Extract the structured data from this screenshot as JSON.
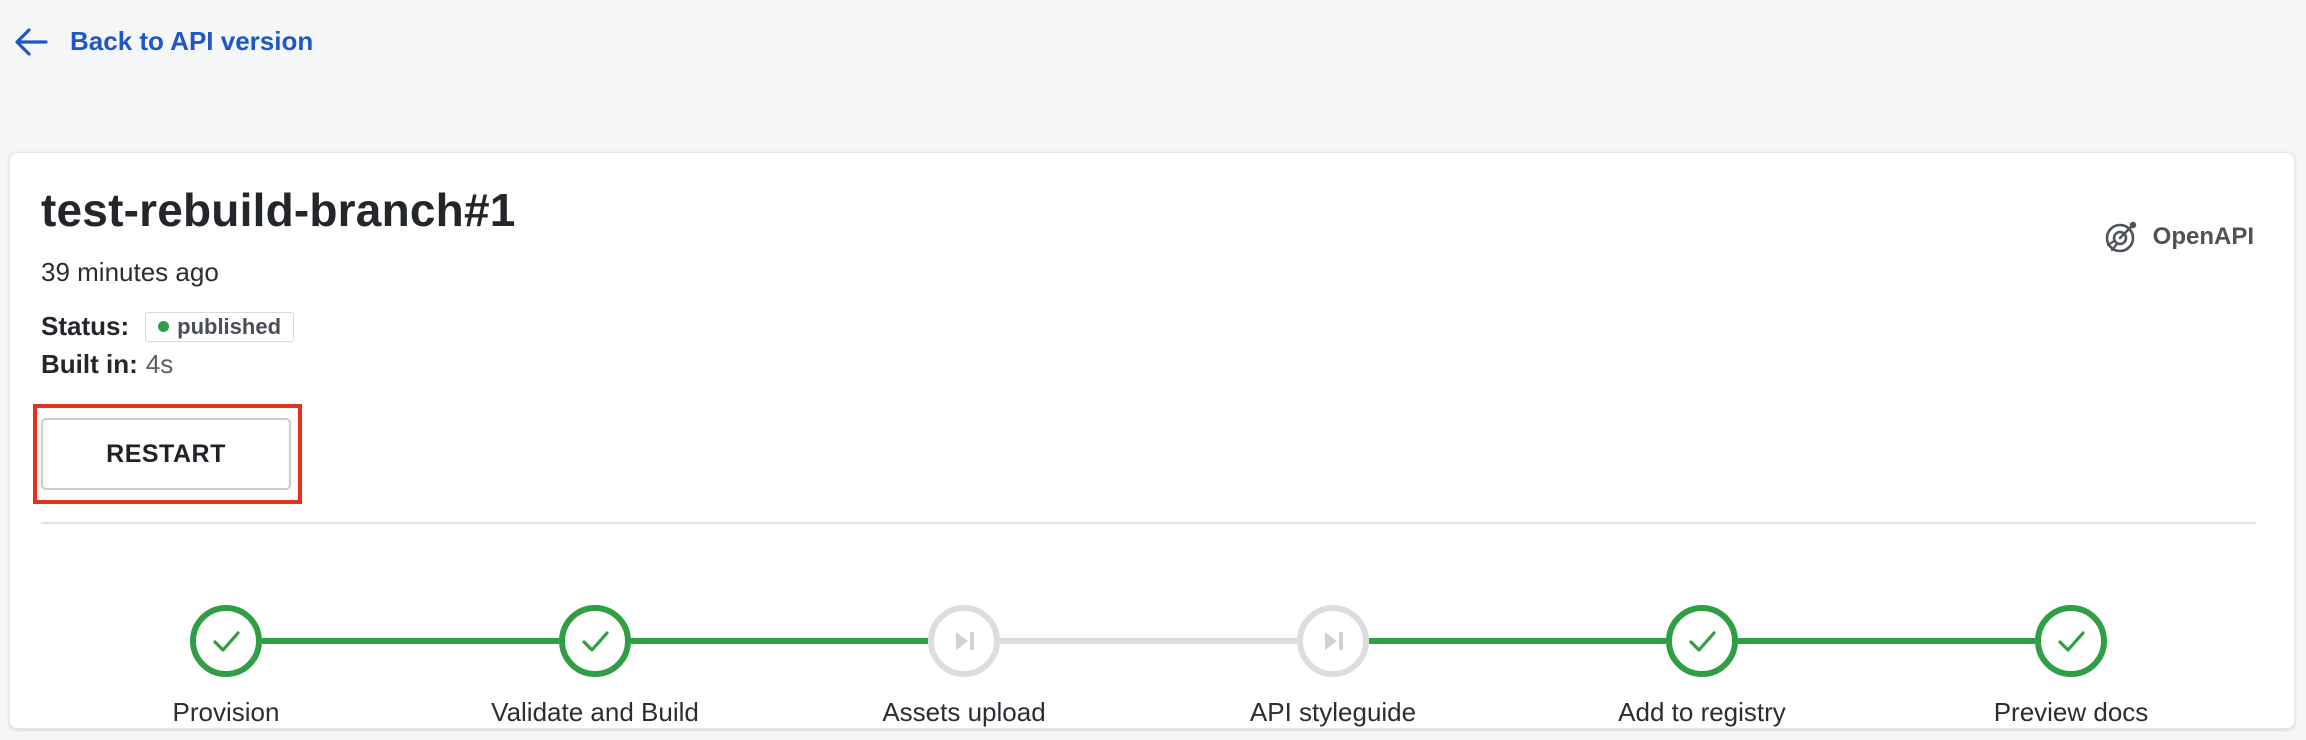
{
  "nav": {
    "back_label": "Back to API version"
  },
  "build": {
    "title": "test-rebuild-branch#1",
    "time_ago": "39 minutes ago",
    "status_label": "Status:",
    "status_value": "published",
    "built_in_label": "Built in:",
    "built_in_value": "4s",
    "restart_label": "RESTART",
    "api_type": "OpenAPI"
  },
  "colors": {
    "link": "#1f57c7",
    "success": "#2f9e44",
    "pending": "#dcdde0",
    "highlight": "#e2321c"
  },
  "pipeline": {
    "steps": [
      {
        "label": "Provision",
        "state": "done",
        "icon": "check-icon"
      },
      {
        "label": "Validate and Build",
        "state": "done",
        "icon": "check-icon"
      },
      {
        "label": "Assets upload",
        "state": "skipped",
        "icon": "skip-icon"
      },
      {
        "label": "API styleguide",
        "state": "skipped",
        "icon": "skip-icon"
      },
      {
        "label": "Add to registry",
        "state": "done",
        "icon": "check-icon"
      },
      {
        "label": "Preview docs",
        "state": "done",
        "icon": "check-icon"
      }
    ],
    "connectors": [
      "done",
      "done",
      "pending",
      "done",
      "done"
    ]
  }
}
